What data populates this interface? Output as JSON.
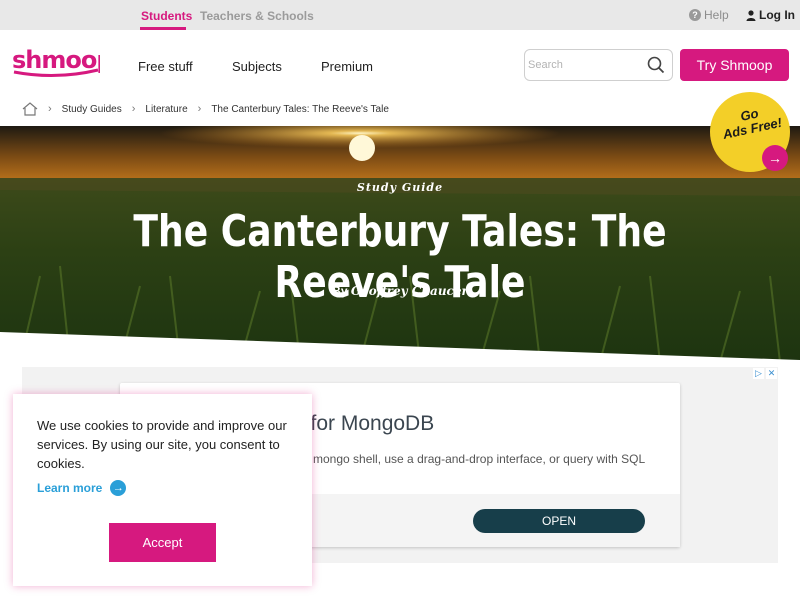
{
  "topbar": {
    "students": "Students",
    "teachers": "Teachers & Schools",
    "help": "Help",
    "help_icon": "?",
    "login": "Log In"
  },
  "logo": {
    "text": "shmoop"
  },
  "nav": {
    "items": [
      {
        "label": "Free stuff"
      },
      {
        "label": "Subjects"
      },
      {
        "label": "Premium"
      }
    ],
    "search_placeholder": "Search",
    "cta": "Try Shmoop"
  },
  "breadcrumb": {
    "items": [
      {
        "label": "Study Guides"
      },
      {
        "label": "Literature"
      },
      {
        "label": "The Canterbury Tales: The Reeve's Tale"
      }
    ]
  },
  "hero": {
    "label": "Study Guide",
    "title": "The Canterbury Tales: The Reeve's Tale",
    "author_prefix": "By",
    "author": "Geoffrey Chaucer"
  },
  "ads_badge": {
    "line1": "Go",
    "line2": "Ads Free!",
    "arrow": "→"
  },
  "ad": {
    "title": "l for MongoDB",
    "description": "mongo shell, use a drag-and-drop interface, or query with SQL",
    "open_label": "OPEN",
    "choices_left": "▷",
    "choices_right": "✕"
  },
  "cookie": {
    "text": "We use cookies to provide and improve our services. By using our site, you consent to cookies.",
    "learn_more": "Learn more",
    "learn_icon": "→",
    "accept": "Accept"
  },
  "colors": {
    "brand": "#d6197f",
    "badge": "#f3cf28",
    "link": "#2a9fd8",
    "ad_button": "#173e4a"
  },
  "icons": [
    "home-icon",
    "chevron-right-icon",
    "search-icon",
    "help-icon",
    "user-icon",
    "arrow-right-icon"
  ]
}
